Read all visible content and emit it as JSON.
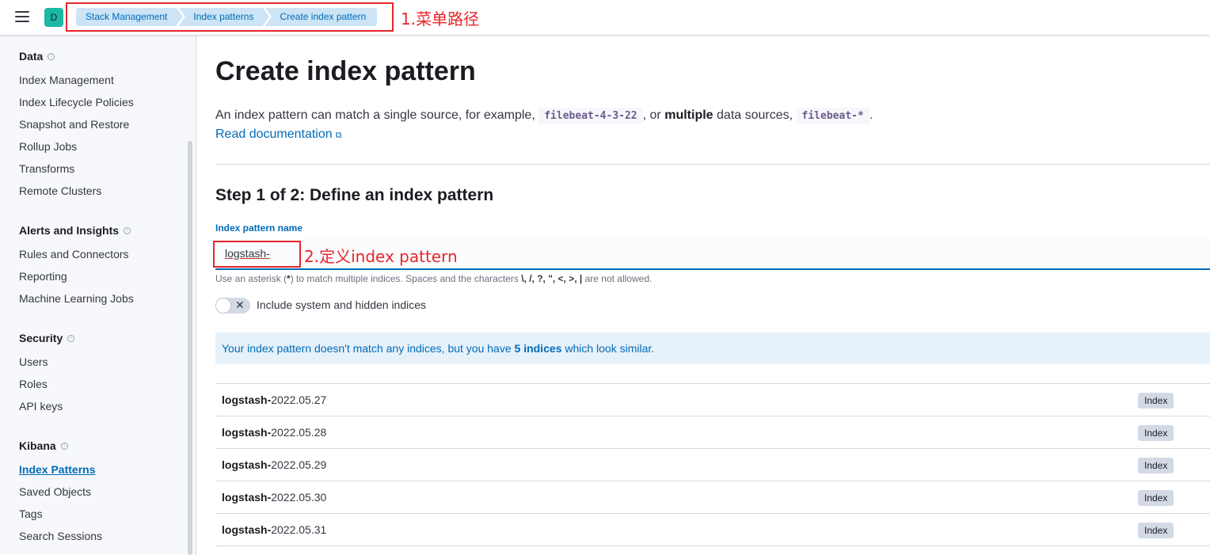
{
  "header": {
    "space_initial": "D",
    "breadcrumbs": [
      "Stack Management",
      "Index patterns",
      "Create index pattern"
    ]
  },
  "annotations": {
    "menu_path": "1.菜单路径",
    "define_pattern": "2.定义index pattern"
  },
  "sidebar": {
    "groups": [
      {
        "title": "Data",
        "items": [
          "Index Management",
          "Index Lifecycle Policies",
          "Snapshot and Restore",
          "Rollup Jobs",
          "Transforms",
          "Remote Clusters"
        ]
      },
      {
        "title": "Alerts and Insights",
        "items": [
          "Rules and Connectors",
          "Reporting",
          "Machine Learning Jobs"
        ]
      },
      {
        "title": "Security",
        "items": [
          "Users",
          "Roles",
          "API keys"
        ]
      },
      {
        "title": "Kibana",
        "items": [
          "Index Patterns",
          "Saved Objects",
          "Tags",
          "Search Sessions"
        ]
      }
    ],
    "active_item": "Index Patterns"
  },
  "main": {
    "title": "Create index pattern",
    "desc_part1": "An index pattern can match a single source, for example,",
    "code1": "filebeat-4-3-22",
    "desc_part2": ", or",
    "desc_bold": "multiple",
    "desc_part3": "data sources,",
    "code2": "filebeat-*",
    "desc_end": ".",
    "doc_link": "Read documentation",
    "step_title": "Step 1 of 2: Define an index pattern",
    "field_label": "Index pattern name",
    "field_value": "logstash-",
    "help_part1": "Use an asterisk (",
    "help_star": "*",
    "help_part2": ") to match multiple indices. Spaces and the characters",
    "help_chars": "\\, /, ?, \", <, >, |",
    "help_part3": "are not allowed.",
    "toggle_label": "Include system and hidden indices",
    "callout_part1": "Your index pattern doesn't match any indices, but you have",
    "callout_bold": "5 indices",
    "callout_part2": "which look similar.",
    "indices": [
      {
        "prefix": "logstash-",
        "suffix": "2022.05.27",
        "badge": "Index"
      },
      {
        "prefix": "logstash-",
        "suffix": "2022.05.28",
        "badge": "Index"
      },
      {
        "prefix": "logstash-",
        "suffix": "2022.05.29",
        "badge": "Index"
      },
      {
        "prefix": "logstash-",
        "suffix": "2022.05.30",
        "badge": "Index"
      },
      {
        "prefix": "logstash-",
        "suffix": "2022.05.31",
        "badge": "Index"
      }
    ]
  },
  "colors": {
    "accent": "#006bb8",
    "annotation": "#e8262b",
    "space_avatar": "#1bb8a6"
  }
}
